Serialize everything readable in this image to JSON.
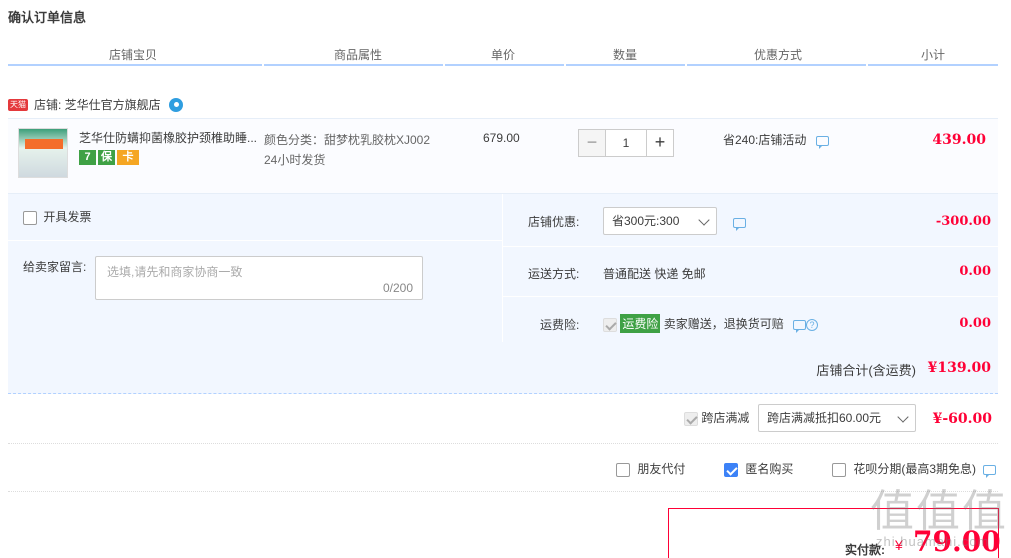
{
  "title": "确认订单信息",
  "columns": [
    "店铺宝贝",
    "商品属性",
    "单价",
    "数量",
    "优惠方式",
    "小计"
  ],
  "shop": {
    "tag": "天猫",
    "name": "店铺: 芝华仕官方旗舰店"
  },
  "item": {
    "name": "芝华仕防螨抑菌橡胶护颈椎助睡...",
    "badges": [
      "7",
      "保",
      "卡"
    ],
    "attr_color": "颜色分类：甜梦枕乳胶枕XJ002",
    "attr_ship": "24小时发货",
    "unit_price": "679.00",
    "quantity": "1",
    "qty_minus": "−",
    "qty_plus": "+",
    "promo": "省240:店铺活动",
    "subtotal": "439.00"
  },
  "options": {
    "invoice_label": "开具发票",
    "message_label": "给卖家留言:",
    "message_placeholder": "选填,请先和商家协商一致",
    "message_count": "0/200",
    "shop_discount_label": "店铺优惠:",
    "shop_discount_value": "省300元:300",
    "shop_discount_amount": "-300.00",
    "shipping_label": "运送方式:",
    "shipping_value": "普通配送 快递 免邮",
    "shipping_amount": "0.00",
    "insurance_label": "运费险:",
    "insurance_tag": "运费险",
    "insurance_text": "卖家赠送，退换货可赔",
    "insurance_amount": "0.00"
  },
  "shop_total": {
    "label": "店铺合计(含运费)",
    "amount": "¥139.00"
  },
  "cross_shop": {
    "label": "跨店满减",
    "select": "跨店满减抵扣60.00元",
    "amount": "¥-60.00"
  },
  "payment": {
    "friend_pay": "朋友代付",
    "anonymous": "匿名购买",
    "huabei": "花呗分期(最高3期免息)"
  },
  "final": {
    "label": "实付款:",
    "currency": "¥",
    "amount": "79.00"
  },
  "watermark": {
    "main": "值值值",
    "sub": "zhi.huamahi.com"
  }
}
